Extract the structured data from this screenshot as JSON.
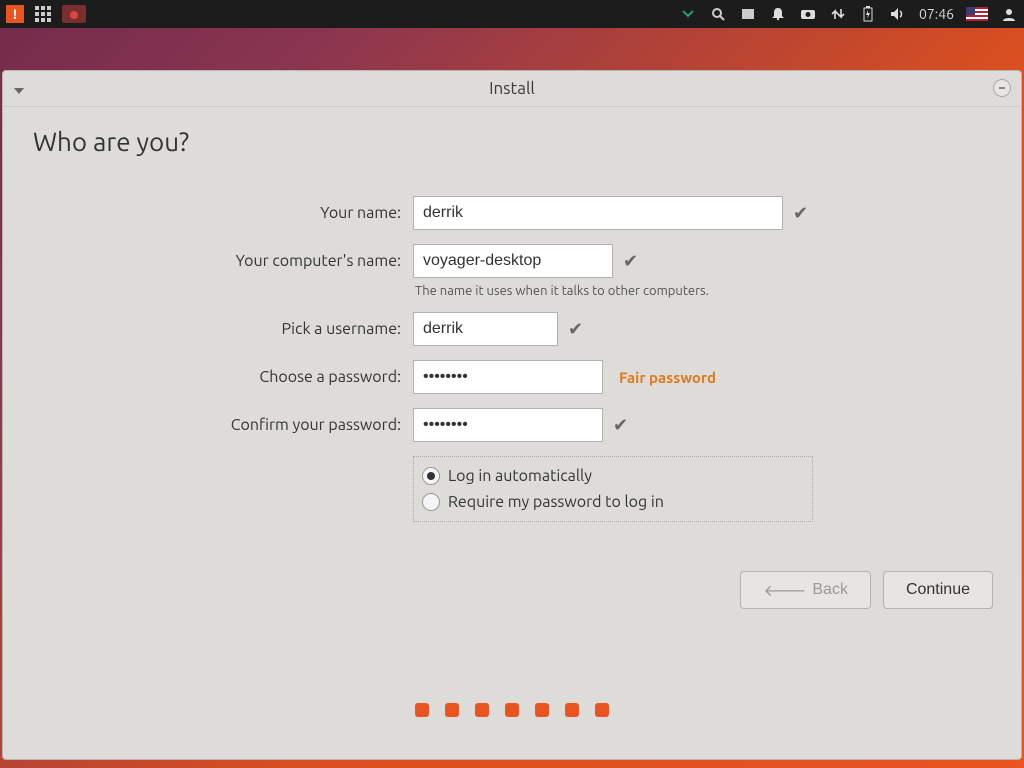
{
  "panel": {
    "time": "07:46"
  },
  "window": {
    "title": "Install"
  },
  "page": {
    "heading": "Who are you?"
  },
  "form": {
    "name_label": "Your name:",
    "name_value": "derrik",
    "computer_label": "Your computer's name:",
    "computer_value": "voyager-desktop",
    "computer_hint": "The name it uses when it talks to other computers.",
    "username_label": "Pick a username:",
    "username_value": "derrik",
    "password_label": "Choose a password:",
    "password_value": "••••••••",
    "password_strength": "Fair password",
    "confirm_label": "Confirm your password:",
    "confirm_value": "••••••••",
    "radio_auto": "Log in automatically",
    "radio_require": "Require my password to log in"
  },
  "buttons": {
    "back": "Back",
    "continue": "Continue"
  }
}
